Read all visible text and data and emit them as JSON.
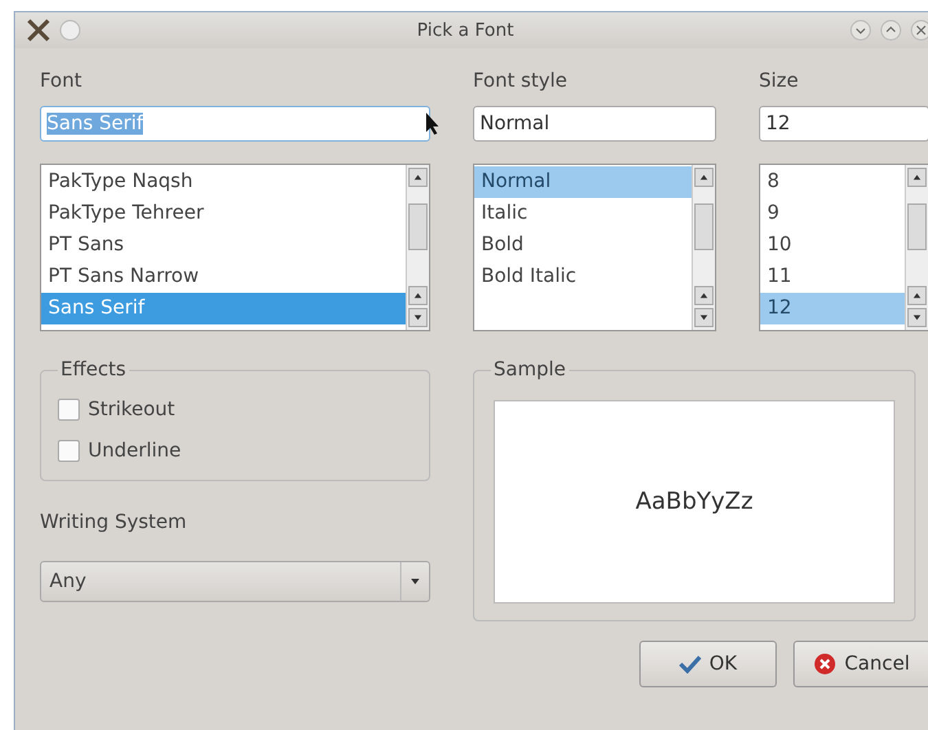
{
  "window": {
    "title": "Pick a Font"
  },
  "font": {
    "label": "Font",
    "value": "Sans Serif",
    "text_selected": true,
    "items": [
      {
        "label": "PakType Naqsh",
        "selected": false
      },
      {
        "label": "PakType Tehreer",
        "selected": false
      },
      {
        "label": "PT Sans",
        "selected": false
      },
      {
        "label": "PT Sans Narrow",
        "selected": false
      },
      {
        "label": "Sans Serif",
        "selected": true
      }
    ]
  },
  "font_style": {
    "label": "Font style",
    "value": "Normal",
    "items": [
      {
        "label": "Normal",
        "selected": true
      },
      {
        "label": "Italic",
        "selected": false
      },
      {
        "label": "Bold",
        "selected": false
      },
      {
        "label": "Bold Italic",
        "selected": false
      }
    ]
  },
  "size": {
    "label": "Size",
    "value": "12",
    "items": [
      {
        "label": "8",
        "selected": false
      },
      {
        "label": "9",
        "selected": false
      },
      {
        "label": "10",
        "selected": false
      },
      {
        "label": "11",
        "selected": false
      },
      {
        "label": "12",
        "selected": true
      }
    ]
  },
  "effects": {
    "title": "Effects",
    "options": [
      {
        "label": "Strikeout",
        "checked": false
      },
      {
        "label": "Underline",
        "checked": false
      }
    ]
  },
  "writing_system": {
    "label": "Writing System",
    "value": "Any"
  },
  "sample": {
    "title": "Sample",
    "text": "AaBbYyZz"
  },
  "buttons": [
    {
      "kind": "ok",
      "label": "OK"
    },
    {
      "kind": "cancel",
      "label": "Cancel"
    }
  ]
}
